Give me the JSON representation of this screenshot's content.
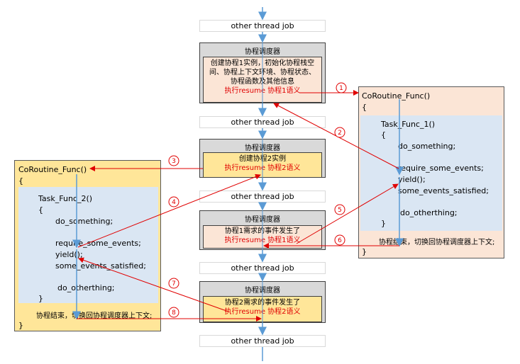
{
  "other_job": "other thread job",
  "scheduler_title": "协程调度器",
  "schedulers": [
    {
      "lines": [
        "创建协程1实例，初始化协程栈空",
        "间、协程上下文环境、协程状态、",
        "协程函数及其他信息"
      ],
      "resume": "执行resume 协程1语义"
    },
    {
      "lines": [
        "创建协程2实例"
      ],
      "resume": "执行resume 协程2语义"
    },
    {
      "lines": [
        "协程1需求的事件发生了"
      ],
      "resume": "执行resume 协程1语义"
    },
    {
      "lines": [
        "协程2需求的事件发生了"
      ],
      "resume": "执行resume 协程2语义"
    }
  ],
  "coroutine1": {
    "header": "CoRoutine_Func()",
    "open": "{",
    "task": "Task_Func_1()",
    "task_open": "{",
    "do_something": "do_something;",
    "require": "require_some_events;",
    "yield": "yield();",
    "satisfied": "some_events_satisfied;",
    "do_other": "do_otherthing;",
    "task_close": "}",
    "end": "协程结束，切换回协程调度器上下文;",
    "close": "}"
  },
  "coroutine2": {
    "header": "CoRoutine_Func()",
    "open": "{",
    "task": "Task_Func_2()",
    "task_open": "{",
    "do_something": "do_something;",
    "require": "require_some_events;",
    "yield": "yield();",
    "satisfied": "some_events_satisfied;",
    "do_other": "do_otherthing;",
    "task_close": "}",
    "end": "协程结束，切换回协程调度器上下文;",
    "close": "}"
  },
  "step_numbers": [
    "1",
    "2",
    "3",
    "4",
    "5",
    "6",
    "7",
    "8"
  ],
  "colors": {
    "arrow_red": "#e00000",
    "flow_blue": "#5b9bd5",
    "peach": "#fbe5d6",
    "yellow": "#ffe699",
    "code_blue": "#dae6f3",
    "scheduler_gray": "#d9d9d9"
  }
}
